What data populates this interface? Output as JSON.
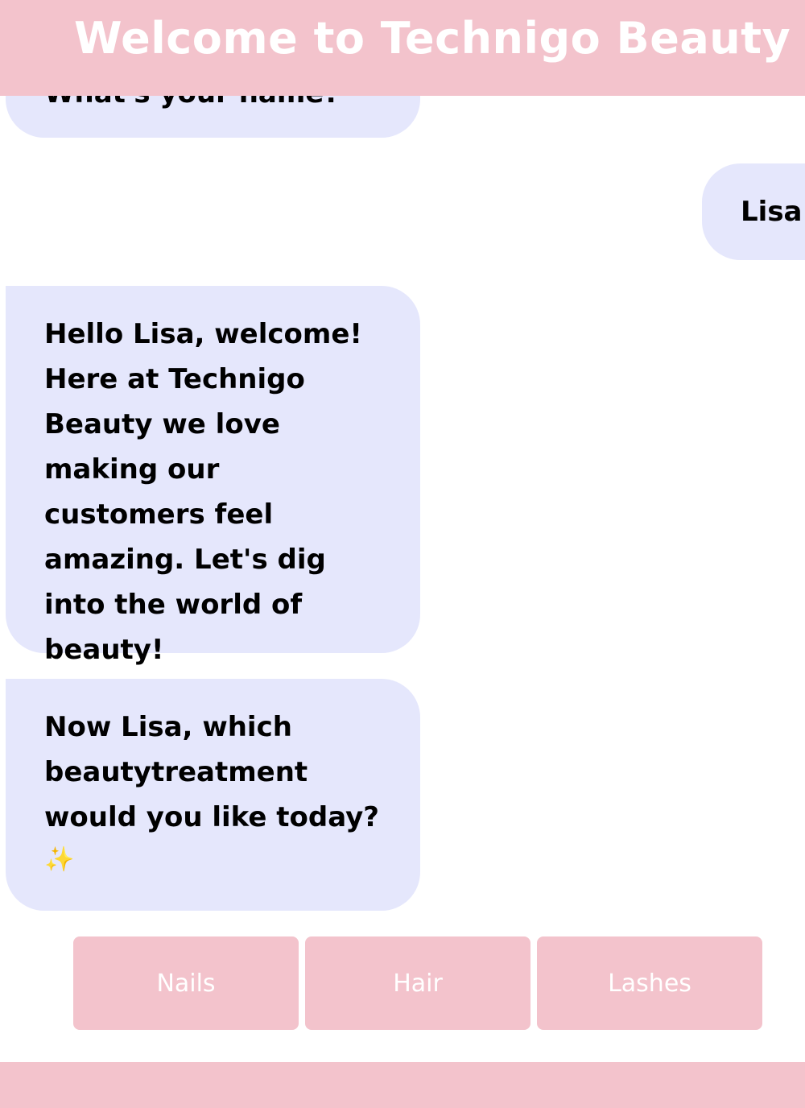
{
  "header": {
    "title": "Welcome to Technigo Beauty"
  },
  "messages": {
    "previous_bot": "What's your name?",
    "user_reply": "Lisa",
    "welcome": "Hello Lisa, welcome! Here at Technigo Beauty we love making our customers feel amazing. Let's dig into the world of beauty!",
    "question": "Now Lisa, which beautytreatment would you like today?",
    "question_emoji": "✨"
  },
  "options": [
    {
      "label": "Nails"
    },
    {
      "label": "Hair"
    },
    {
      "label": "Lashes"
    }
  ],
  "colors": {
    "brand_pink": "#f3c3cc",
    "bubble_lavender": "#e5e7fc",
    "text": "#000000",
    "button_text": "#ffffff"
  }
}
